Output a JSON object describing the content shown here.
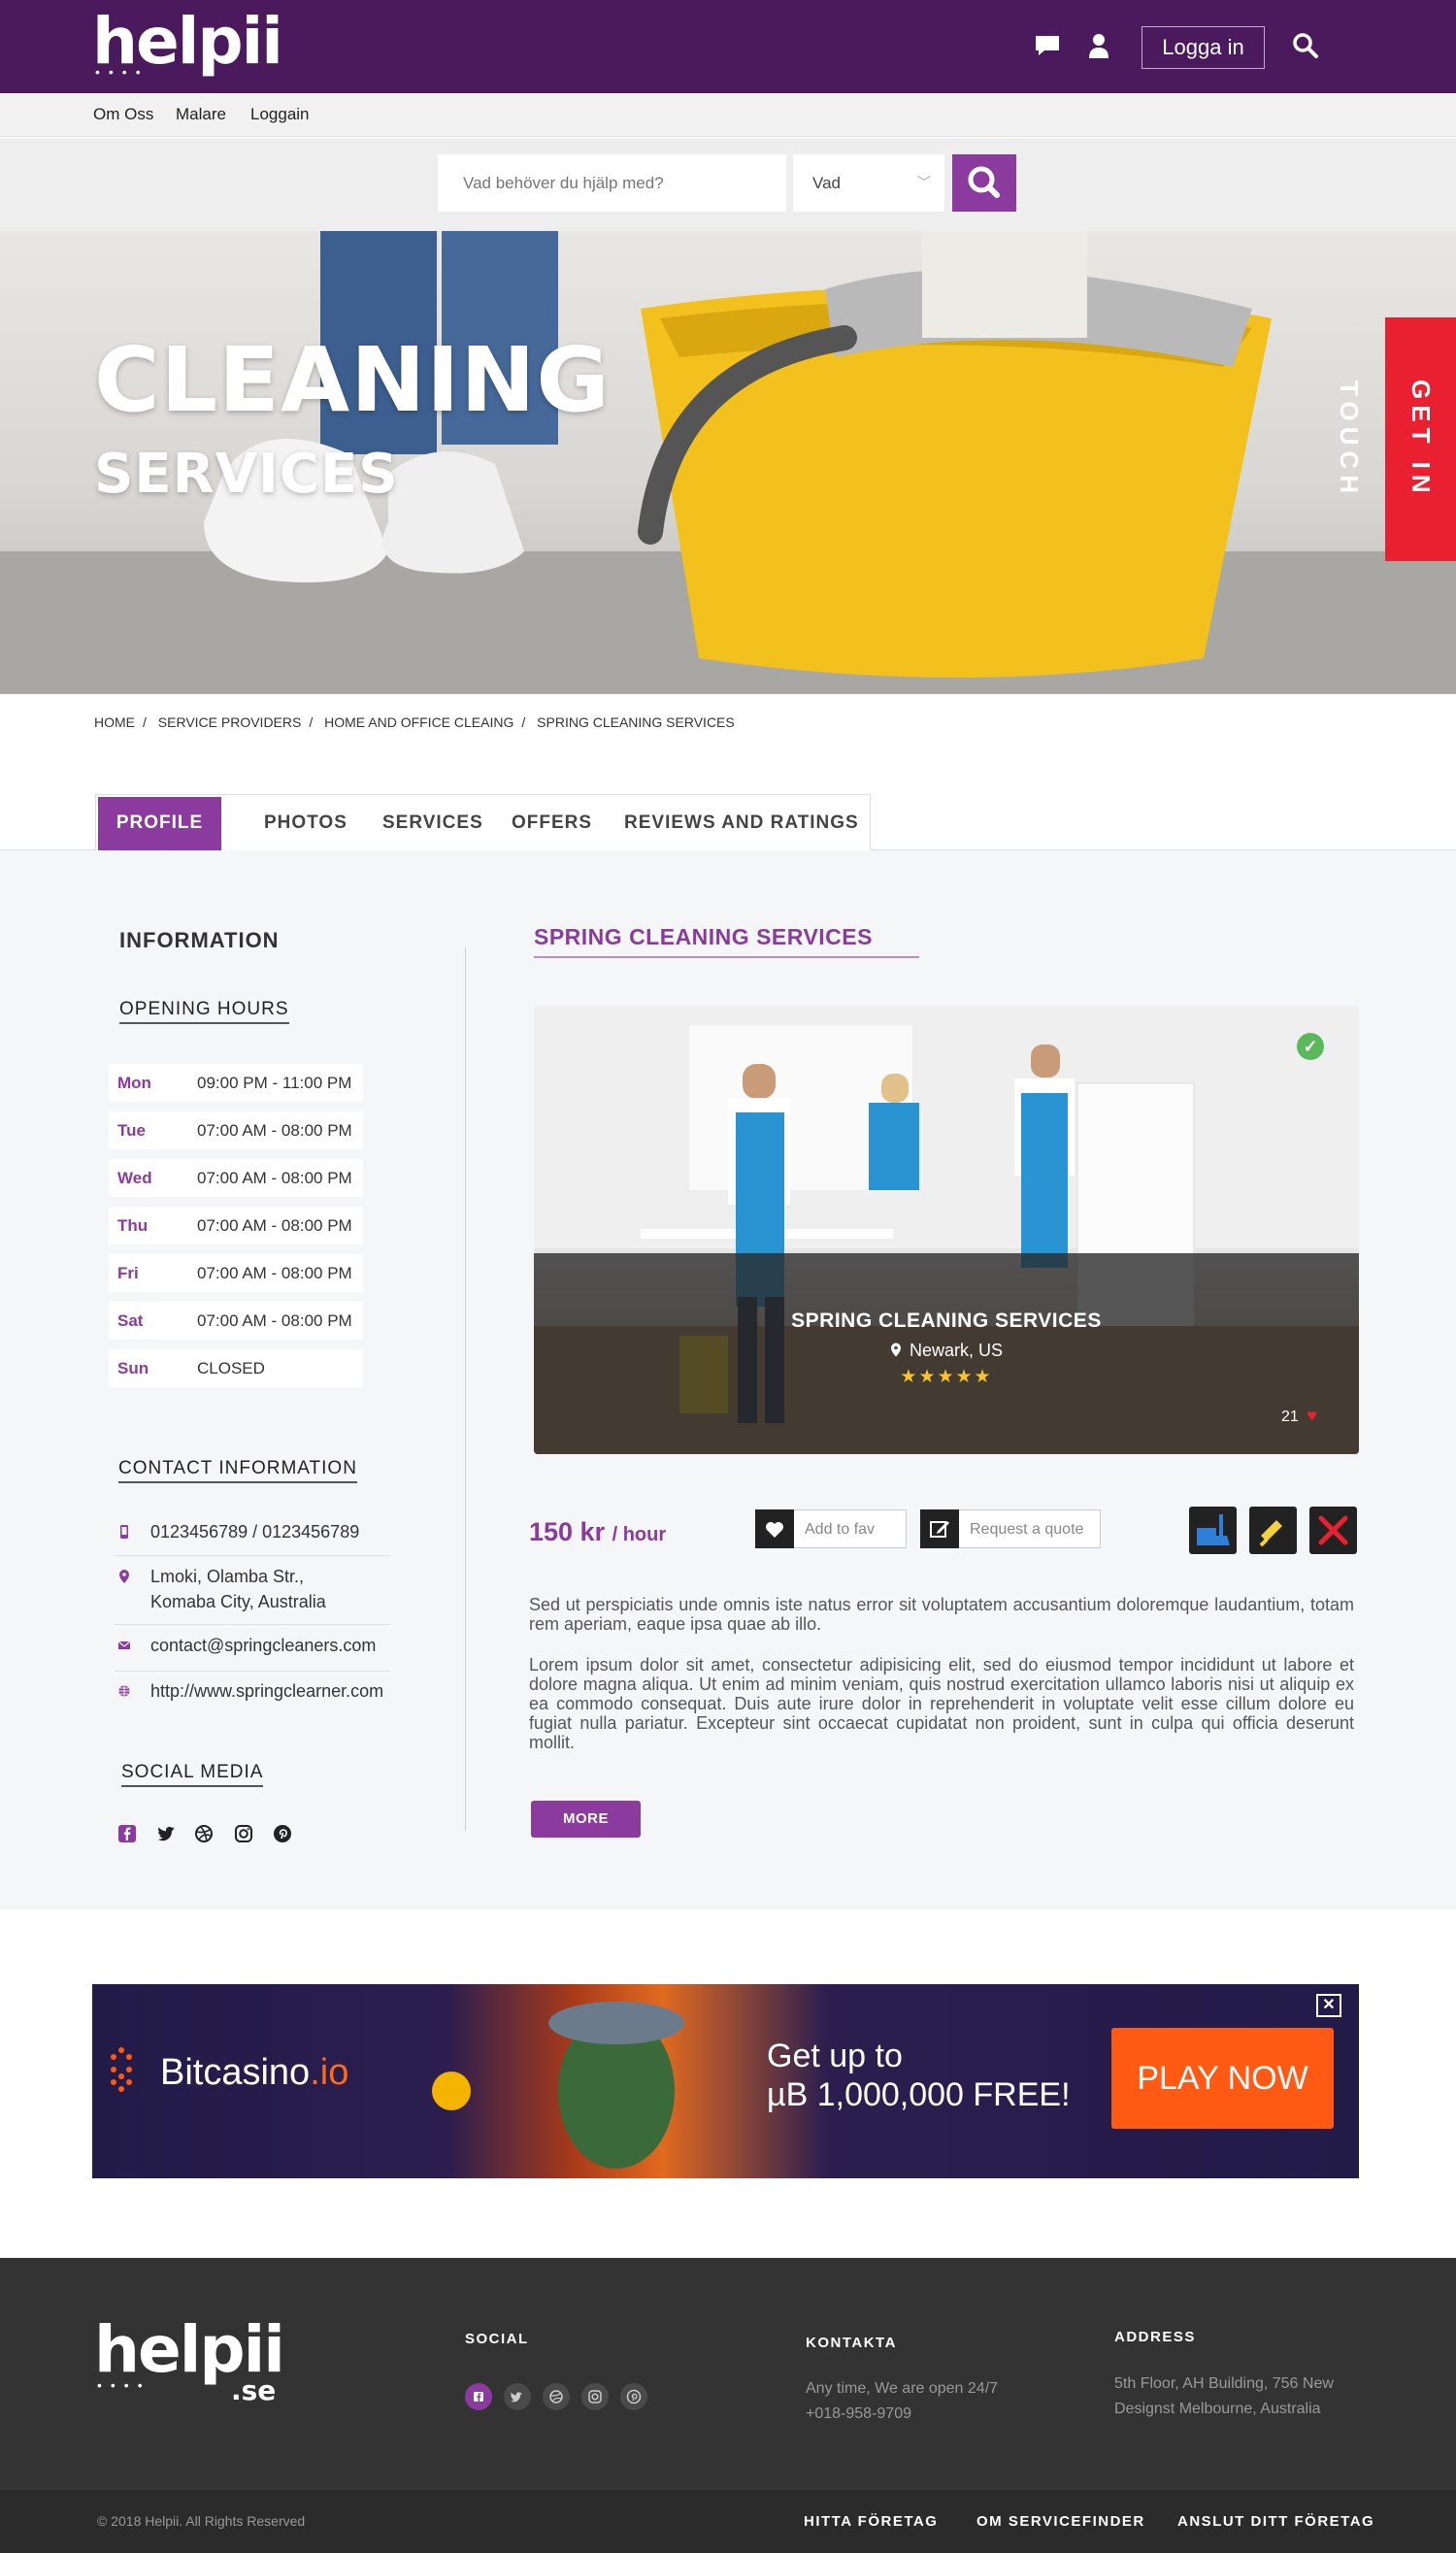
{
  "header": {
    "logo": "helpii",
    "login_label": "Logga in"
  },
  "subnav": [
    "Om Oss",
    "Malare",
    "Loggain"
  ],
  "search": {
    "placeholder": "Vad behöver du hjälp med?",
    "select_value": "Vad"
  },
  "hero": {
    "title": "CLEANING",
    "subtitle": "SERVICES",
    "cta": "GET IN TOUCH"
  },
  "breadcrumb": [
    "HOME",
    "SERVICE PROVIDERS",
    "HOME AND OFFICE CLEAING",
    "SPRING CLEANING SERVICES"
  ],
  "tabs": [
    "PROFILE",
    "PHOTOS",
    "SERVICES",
    "OFFERS",
    "REVIEWS AND RATINGS"
  ],
  "sidebar": {
    "info_title": "INFORMATION",
    "hours_title": "OPENING HOURS",
    "hours": [
      {
        "day": "Mon",
        "time": "09:00 PM - 11:00 PM"
      },
      {
        "day": "Tue",
        "time": "07:00 AM - 08:00 PM"
      },
      {
        "day": "Wed",
        "time": "07:00 AM - 08:00 PM"
      },
      {
        "day": "Thu",
        "time": "07:00 AM - 08:00 PM"
      },
      {
        "day": "Fri",
        "time": "07:00 AM - 08:00 PM"
      },
      {
        "day": "Sat",
        "time": "07:00 AM - 08:00 PM"
      },
      {
        "day": "Sun",
        "time": "CLOSED"
      }
    ],
    "contact_title": "CONTACT INFORMATION",
    "contact": {
      "phone": "0123456789 / 0123456789",
      "address_line1": "Lmoki, Olamba Str.,",
      "address_line2": "Komaba City, Australia",
      "email": "contact@springcleaners.com",
      "website": "http://www.springclearner.com"
    },
    "social_title": "SOCIAL MEDIA"
  },
  "business": {
    "name": "SPRING CLEANING SERVICES",
    "card_name": "SPRING CLEANING SERVICES",
    "location": "Newark, US",
    "rating": 5,
    "likes": "21",
    "price": "150 kr",
    "price_unit": "/ hour",
    "fav_label": "Add to fav",
    "quote_label": "Request a quote",
    "para1": "Sed ut perspiciatis unde omnis iste natus error sit voluptatem accusantium doloremque laudantium, totam rem aperiam, eaque ipsa quae ab illo.",
    "para2": "Lorem ipsum dolor sit amet, consectetur adipisicing elit, sed do eiusmod tempor incididunt ut labore et dolore magna aliqua. Ut enim ad minim veniam, quis nostrud exercitation ullamco laboris nisi ut aliquip ex ea commodo consequat. Duis aute irure dolor in reprehenderit in voluptate velit esse cillum dolore eu fugiat nulla pariatur. Excepteur sint occaecat cupidatat non proident, sunt in culpa qui officia deserunt mollit.",
    "more_label": "MORE"
  },
  "ad": {
    "brand": "Bitcasino",
    "brand_suffix": ".io",
    "headline_line1": "Get up to",
    "headline_line2": "µB 1,000,000 FREE!",
    "cta": "PLAY NOW"
  },
  "footer": {
    "logo": "helpii",
    "logo_suffix": ".se",
    "social_title": "SOCIAL",
    "contact_title": "KONTAKTA",
    "contact_line1": "Any time, We are open 24/7",
    "contact_line2": "+018-958-9709",
    "address_title": "ADDRESS",
    "address_line1": "5th Floor, AH Building, 756 New",
    "address_line2": "Designst Melbourne, Australia",
    "copyright": "© 2018 Helpii. All Rights Reserved",
    "links": [
      "HITTA FÖRETAG",
      "OM SERVICEFINDER",
      "ANSLUT DITT FÖRETAG"
    ]
  },
  "colors": {
    "brand": "#4b1a5c",
    "accent": "#8b3a9e",
    "cta_red": "#e8202f",
    "ad_orange": "#ff5a14"
  }
}
